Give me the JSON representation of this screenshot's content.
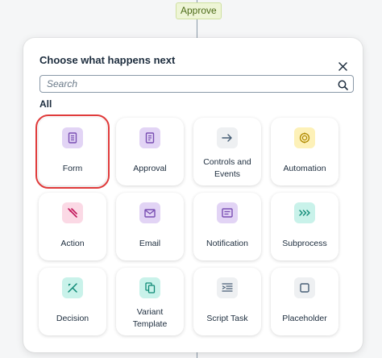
{
  "flow": {
    "approve_label": "Approve"
  },
  "dialog": {
    "title": "Choose what happens next",
    "search_placeholder": "Search",
    "section": "All"
  },
  "tiles": [
    {
      "label": "Form",
      "icon": "form-icon",
      "color": "#e2d4f5",
      "fg": "#7a4fb3",
      "selected": true
    },
    {
      "label": "Approval",
      "icon": "approval-icon",
      "color": "#e2d4f5",
      "fg": "#7a4fb3"
    },
    {
      "label": "Controls and Events",
      "icon": "arrow-right-icon",
      "color": "#eef0f2",
      "fg": "#475e75"
    },
    {
      "label": "Automation",
      "icon": "automation-icon",
      "color": "#fdf1b8",
      "fg": "#b08a00"
    },
    {
      "label": "Action",
      "icon": "action-icon",
      "color": "#fbd9e5",
      "fg": "#c2185b"
    },
    {
      "label": "Email",
      "icon": "email-icon",
      "color": "#e2d4f5",
      "fg": "#7a4fb3"
    },
    {
      "label": "Notification",
      "icon": "notification-icon",
      "color": "#e2d4f5",
      "fg": "#7a4fb3"
    },
    {
      "label": "Subprocess",
      "icon": "subprocess-icon",
      "color": "#c9f2ea",
      "fg": "#0f8a76"
    },
    {
      "label": "Decision",
      "icon": "decision-icon",
      "color": "#c9f2ea",
      "fg": "#0f8a76"
    },
    {
      "label": "Variant Template",
      "icon": "variant-icon",
      "color": "#c9f2ea",
      "fg": "#0f8a76"
    },
    {
      "label": "Script Task",
      "icon": "script-icon",
      "color": "#eef0f2",
      "fg": "#475e75"
    },
    {
      "label": "Placeholder",
      "icon": "placeholder-icon",
      "color": "#eef0f2",
      "fg": "#475e75"
    }
  ]
}
